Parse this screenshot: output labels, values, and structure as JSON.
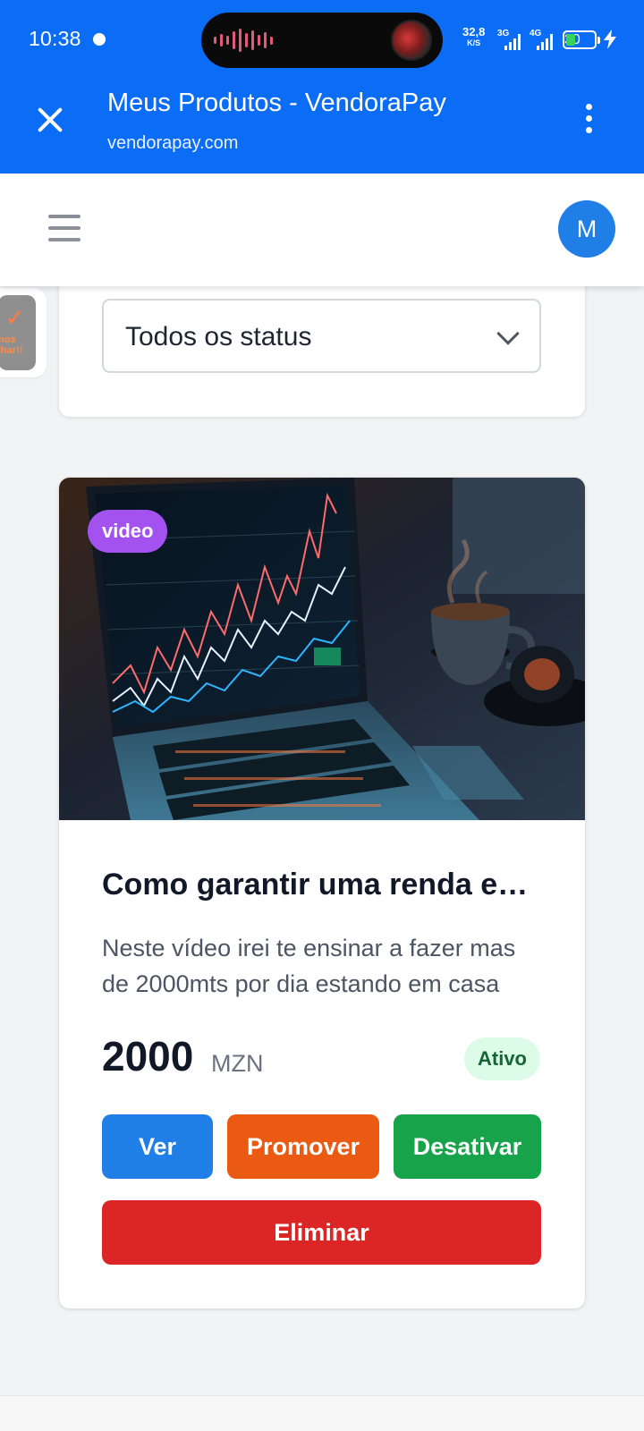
{
  "status_bar": {
    "time": "10:38",
    "net_speed": "32,8",
    "net_unit": "K/S",
    "network_1": "3G",
    "network_2": "4G",
    "battery": "30"
  },
  "browser": {
    "title": "Meus Produtos - VendoraPay",
    "url": "vendorapay.com"
  },
  "header": {
    "avatar_initial": "M"
  },
  "side_bubble": {
    "text": "nos lhar!!"
  },
  "filter": {
    "status_selected": "Todos os status"
  },
  "product": {
    "type_badge": "video",
    "title": "Como garantir uma renda extra",
    "description": "Neste vídeo irei te ensinar a fazer mas de 2000mts por dia estando em casa",
    "price": "2000",
    "currency": "MZN",
    "status": "Ativo",
    "actions": {
      "view": "Ver",
      "promote": "Promover",
      "deactivate": "Desativar",
      "delete": "Eliminar"
    }
  },
  "colors": {
    "browser_bar": "#0b6cf5",
    "avatar": "#1f7fe6",
    "badge_video": "#a352f0",
    "btn_view": "#1f7fe6",
    "btn_promote": "#ea5a12",
    "btn_deactivate": "#16a34a",
    "btn_delete": "#dc2626",
    "status_active_bg": "#dcfce7"
  },
  "icons": {
    "close": "close-icon",
    "menu": "kebab-menu-icon",
    "hamburger": "hamburger-icon",
    "dropdown": "chevron-down-icon"
  }
}
